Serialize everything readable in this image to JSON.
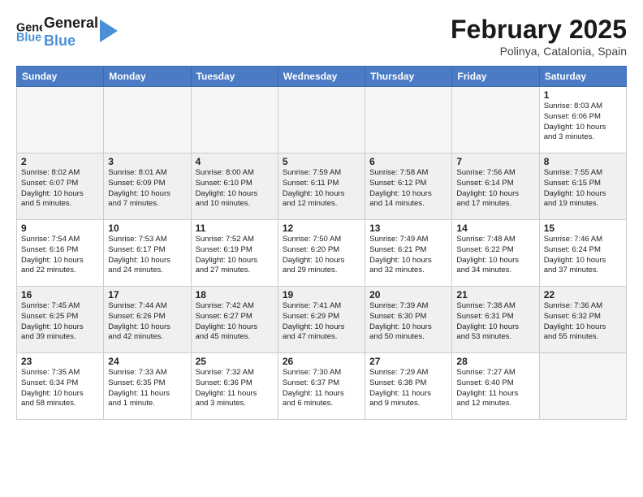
{
  "header": {
    "logo_general": "General",
    "logo_blue": "Blue",
    "month_title": "February 2025",
    "location": "Polinya, Catalonia, Spain"
  },
  "days_of_week": [
    "Sunday",
    "Monday",
    "Tuesday",
    "Wednesday",
    "Thursday",
    "Friday",
    "Saturday"
  ],
  "weeks": [
    [
      {
        "day": "",
        "info": ""
      },
      {
        "day": "",
        "info": ""
      },
      {
        "day": "",
        "info": ""
      },
      {
        "day": "",
        "info": ""
      },
      {
        "day": "",
        "info": ""
      },
      {
        "day": "",
        "info": ""
      },
      {
        "day": "1",
        "info": "Sunrise: 8:03 AM\nSunset: 6:06 PM\nDaylight: 10 hours\nand 3 minutes."
      }
    ],
    [
      {
        "day": "2",
        "info": "Sunrise: 8:02 AM\nSunset: 6:07 PM\nDaylight: 10 hours\nand 5 minutes."
      },
      {
        "day": "3",
        "info": "Sunrise: 8:01 AM\nSunset: 6:09 PM\nDaylight: 10 hours\nand 7 minutes."
      },
      {
        "day": "4",
        "info": "Sunrise: 8:00 AM\nSunset: 6:10 PM\nDaylight: 10 hours\nand 10 minutes."
      },
      {
        "day": "5",
        "info": "Sunrise: 7:59 AM\nSunset: 6:11 PM\nDaylight: 10 hours\nand 12 minutes."
      },
      {
        "day": "6",
        "info": "Sunrise: 7:58 AM\nSunset: 6:12 PM\nDaylight: 10 hours\nand 14 minutes."
      },
      {
        "day": "7",
        "info": "Sunrise: 7:56 AM\nSunset: 6:14 PM\nDaylight: 10 hours\nand 17 minutes."
      },
      {
        "day": "8",
        "info": "Sunrise: 7:55 AM\nSunset: 6:15 PM\nDaylight: 10 hours\nand 19 minutes."
      }
    ],
    [
      {
        "day": "9",
        "info": "Sunrise: 7:54 AM\nSunset: 6:16 PM\nDaylight: 10 hours\nand 22 minutes."
      },
      {
        "day": "10",
        "info": "Sunrise: 7:53 AM\nSunset: 6:17 PM\nDaylight: 10 hours\nand 24 minutes."
      },
      {
        "day": "11",
        "info": "Sunrise: 7:52 AM\nSunset: 6:19 PM\nDaylight: 10 hours\nand 27 minutes."
      },
      {
        "day": "12",
        "info": "Sunrise: 7:50 AM\nSunset: 6:20 PM\nDaylight: 10 hours\nand 29 minutes."
      },
      {
        "day": "13",
        "info": "Sunrise: 7:49 AM\nSunset: 6:21 PM\nDaylight: 10 hours\nand 32 minutes."
      },
      {
        "day": "14",
        "info": "Sunrise: 7:48 AM\nSunset: 6:22 PM\nDaylight: 10 hours\nand 34 minutes."
      },
      {
        "day": "15",
        "info": "Sunrise: 7:46 AM\nSunset: 6:24 PM\nDaylight: 10 hours\nand 37 minutes."
      }
    ],
    [
      {
        "day": "16",
        "info": "Sunrise: 7:45 AM\nSunset: 6:25 PM\nDaylight: 10 hours\nand 39 minutes."
      },
      {
        "day": "17",
        "info": "Sunrise: 7:44 AM\nSunset: 6:26 PM\nDaylight: 10 hours\nand 42 minutes."
      },
      {
        "day": "18",
        "info": "Sunrise: 7:42 AM\nSunset: 6:27 PM\nDaylight: 10 hours\nand 45 minutes."
      },
      {
        "day": "19",
        "info": "Sunrise: 7:41 AM\nSunset: 6:29 PM\nDaylight: 10 hours\nand 47 minutes."
      },
      {
        "day": "20",
        "info": "Sunrise: 7:39 AM\nSunset: 6:30 PM\nDaylight: 10 hours\nand 50 minutes."
      },
      {
        "day": "21",
        "info": "Sunrise: 7:38 AM\nSunset: 6:31 PM\nDaylight: 10 hours\nand 53 minutes."
      },
      {
        "day": "22",
        "info": "Sunrise: 7:36 AM\nSunset: 6:32 PM\nDaylight: 10 hours\nand 55 minutes."
      }
    ],
    [
      {
        "day": "23",
        "info": "Sunrise: 7:35 AM\nSunset: 6:34 PM\nDaylight: 10 hours\nand 58 minutes."
      },
      {
        "day": "24",
        "info": "Sunrise: 7:33 AM\nSunset: 6:35 PM\nDaylight: 11 hours\nand 1 minute."
      },
      {
        "day": "25",
        "info": "Sunrise: 7:32 AM\nSunset: 6:36 PM\nDaylight: 11 hours\nand 3 minutes."
      },
      {
        "day": "26",
        "info": "Sunrise: 7:30 AM\nSunset: 6:37 PM\nDaylight: 11 hours\nand 6 minutes."
      },
      {
        "day": "27",
        "info": "Sunrise: 7:29 AM\nSunset: 6:38 PM\nDaylight: 11 hours\nand 9 minutes."
      },
      {
        "day": "28",
        "info": "Sunrise: 7:27 AM\nSunset: 6:40 PM\nDaylight: 11 hours\nand 12 minutes."
      },
      {
        "day": "",
        "info": ""
      }
    ]
  ]
}
